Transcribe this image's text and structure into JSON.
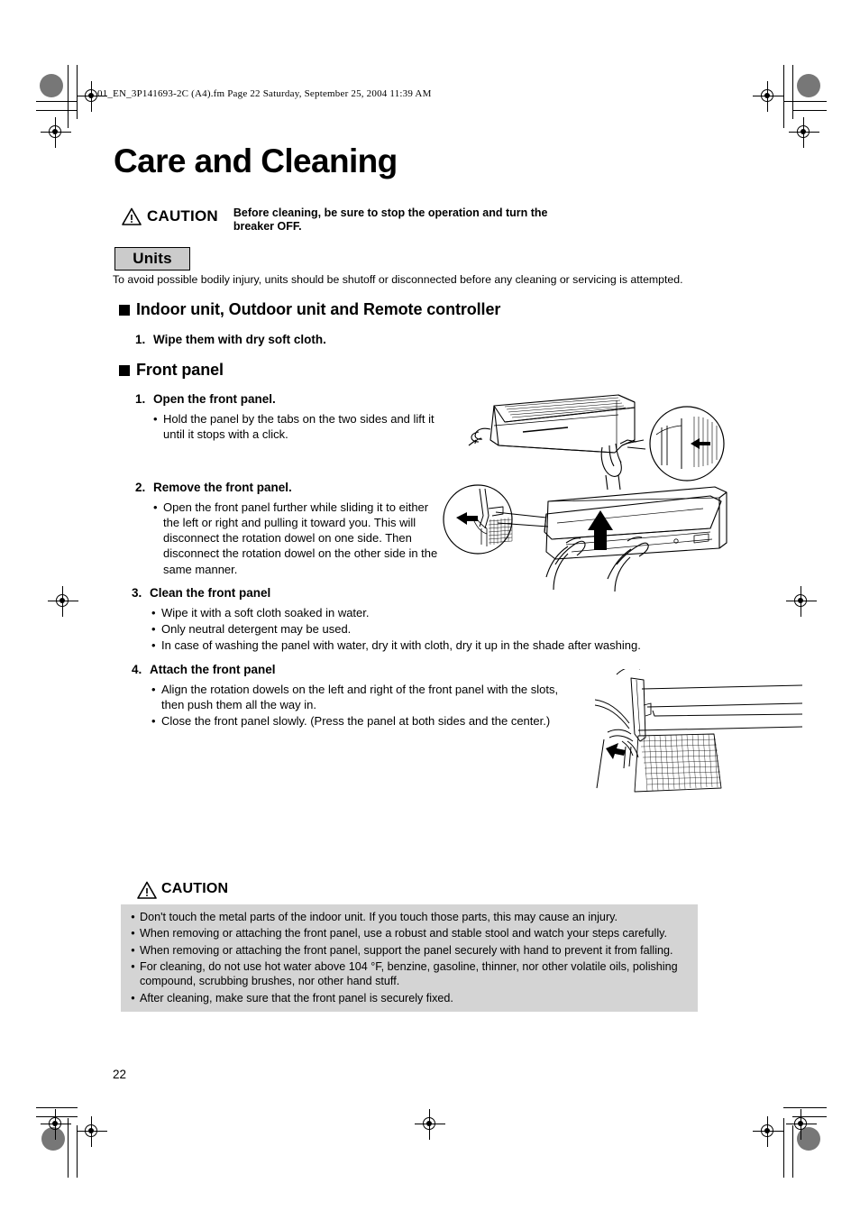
{
  "document": {
    "file_header": "01_EN_3P141693-2C (A4).fm  Page 22  Saturday, September 25, 2004  11:39 AM",
    "title": "Care and Cleaning",
    "page_number": "22"
  },
  "caution_top": {
    "icon": "warning-triangle-icon",
    "label": "CAUTION",
    "message": "Before cleaning, be sure to stop the operation and turn the breaker OFF."
  },
  "units": {
    "badge_label": "Units",
    "note": "To avoid possible bodily injury, units should be shutoff or disconnected before any cleaning or servicing is attempted."
  },
  "sections": [
    {
      "heading": "Indoor unit, Outdoor unit and Remote controller",
      "steps": [
        {
          "number": "1.",
          "title": "Wipe them with dry soft cloth.",
          "bullets": []
        }
      ]
    },
    {
      "heading": "Front panel",
      "steps": [
        {
          "number": "1.",
          "title": "Open the front panel.",
          "bullets": [
            "Hold the panel by the tabs on the two sides and lift it until it stops with a click."
          ]
        },
        {
          "number": "2.",
          "title": "Remove the front panel.",
          "bullets": [
            "Open the front panel further while sliding it to either the left or right and pulling it toward you. This will disconnect the rotation dowel on one side. Then disconnect the rotation dowel on the other side in the same manner."
          ]
        },
        {
          "number": "3.",
          "title": "Clean the front panel",
          "bullets": [
            "Wipe it with a soft cloth soaked in water.",
            "Only neutral detergent may be used.",
            "In case of washing  the panel with water, dry it with cloth, dry it up in the shade after washing."
          ]
        },
        {
          "number": "4.",
          "title": "Attach the front panel",
          "bullets": [
            "Align the rotation dowels on the left and right of the front panel with the slots, then push them all the way in.",
            "Close the front panel slowly. (Press the panel at both sides and the center.)"
          ]
        }
      ]
    }
  ],
  "caution_bottom": {
    "icon": "warning-triangle-icon",
    "label": "CAUTION",
    "bullets": [
      "Don't touch the metal parts of the indoor unit. If you touch those parts, this may cause an injury.",
      "When removing or attaching the front panel, use a robust and stable stool and watch your steps carefully.",
      "When removing or attaching the front panel, support the panel securely with hand to prevent it from falling.",
      "For cleaning, do not use hot water above 104 °F, benzine, gasoline, thinner, nor other volatile oils, polishing compound, scrubbing brushes, nor other hand stuff.",
      "After cleaning, make sure that the front panel is securely fixed."
    ]
  },
  "illustrations": [
    {
      "name": "open-front-panel-illustration",
      "caption": ""
    },
    {
      "name": "remove-front-panel-illustration",
      "caption": ""
    },
    {
      "name": "attach-front-panel-illustration",
      "caption": ""
    }
  ],
  "colors": {
    "badge_bg": "#cbcbcb",
    "caution_box_bg": "#d4d4d4",
    "text": "#000000",
    "page_bg": "#ffffff"
  }
}
